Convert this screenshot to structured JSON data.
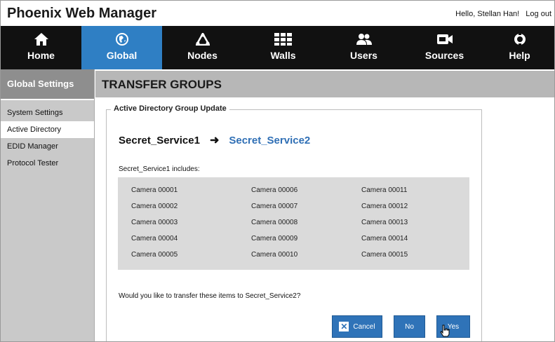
{
  "header": {
    "app_title": "Phoenix Web Manager",
    "greeting": "Hello, Stellan Han!",
    "logout_label": "Log out"
  },
  "nav": {
    "items": [
      {
        "label": "Home",
        "icon": "home-icon",
        "active": false
      },
      {
        "label": "Global",
        "icon": "globe-icon",
        "active": true
      },
      {
        "label": "Nodes",
        "icon": "nodes-icon",
        "active": false
      },
      {
        "label": "Walls",
        "icon": "walls-icon",
        "active": false
      },
      {
        "label": "Users",
        "icon": "users-icon",
        "active": false
      },
      {
        "label": "Sources",
        "icon": "camera-icon",
        "active": false
      },
      {
        "label": "Help",
        "icon": "lifebuoy-icon",
        "active": false
      }
    ]
  },
  "sidebar": {
    "title": "Global Settings",
    "items": [
      {
        "label": "System Settings",
        "active": false
      },
      {
        "label": "Active Directory",
        "active": true
      },
      {
        "label": "EDID Manager",
        "active": false
      },
      {
        "label": "Protocol Tester",
        "active": false
      }
    ]
  },
  "main": {
    "title": "TRANSFER GROUPS",
    "fieldset_legend": "Active Directory Group Update",
    "from_group": "Secret_Service1",
    "to_group": "Secret_Service2",
    "includes_label": "Secret_Service1 includes:",
    "cameras": [
      "Camera 00001",
      "Camera 00002",
      "Camera 00003",
      "Camera 00004",
      "Camera 00005",
      "Camera 00006",
      "Camera 00007",
      "Camera 00008",
      "Camera 00009",
      "Camera 00010",
      "Camera 00011",
      "Camera 00012",
      "Camera 00013",
      "Camera 00014",
      "Camera 00015"
    ],
    "question": "Would you like to transfer these items to Secret_Service2?",
    "buttons": {
      "cancel": "Cancel",
      "no": "No",
      "yes": "Yes"
    }
  },
  "colors": {
    "nav_background": "#111111",
    "nav_active": "#2f7fc4",
    "accent_blue": "#2f6fb5",
    "button_blue": "#2f73b8"
  }
}
